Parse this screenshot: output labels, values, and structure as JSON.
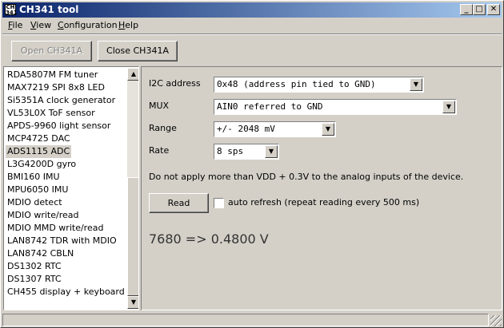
{
  "window": {
    "title": "CH341 tool",
    "icon_text": "CH 341"
  },
  "titlebar_buttons": {
    "minimize": "_",
    "maximize": "□",
    "close": "✕"
  },
  "menu": [
    {
      "label": "File",
      "u": "F",
      "rest": "ile"
    },
    {
      "label": "View",
      "u": "V",
      "rest": "iew"
    },
    {
      "label": "Configuration",
      "u": "C",
      "rest": "onfiguration"
    },
    {
      "label": "Help",
      "u": "H",
      "rest": "elp"
    }
  ],
  "toolbar": {
    "open_label": "Open CH341A",
    "close_label": "Close CH341A"
  },
  "device_list": {
    "selected": "ADS1115 ADC",
    "items": [
      "RDA5807M FM tuner",
      "MAX7219 SPI 8x8 LED",
      "Si5351A clock generator",
      "VL53L0X ToF sensor",
      "APDS-9960 light sensor",
      "MCP4725 DAC",
      "ADS1115 ADC",
      "L3G4200D gyro",
      "BMI160 IMU",
      "MPU6050 IMU",
      "MDIO detect",
      "MDIO write/read",
      "MDIO MMD write/read",
      "LAN8742 TDR with MDIO",
      "LAN8742 CBLN",
      "DS1302 RTC",
      "DS1307 RTC",
      "CH455 display + keyboard"
    ]
  },
  "form": {
    "i2c_label": "I2C address",
    "i2c_value": "0x48 (address pin tied to GND)",
    "mux_label": "MUX",
    "mux_value": "AIN0 referred to GND",
    "range_label": "Range",
    "range_value": "+/- 2048 mV",
    "rate_label": "Rate",
    "rate_value": "8 sps",
    "warning": "Do not apply more than VDD + 0.3V to the analog inputs of the device.",
    "read_label": "Read",
    "auto_refresh_label": "auto refresh (repeat reading every 500 ms)",
    "auto_refresh_checked": false,
    "result": "7680 => 0.4800 V"
  }
}
